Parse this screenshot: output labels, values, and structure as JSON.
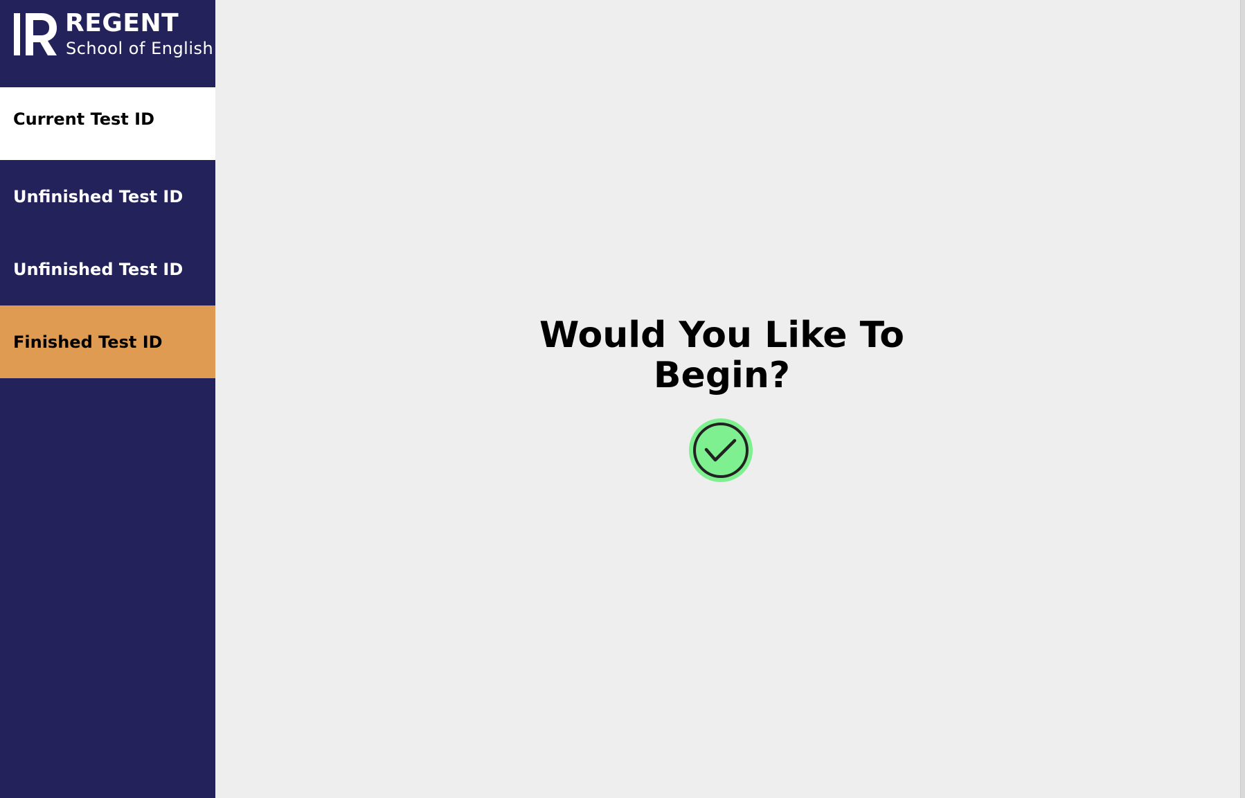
{
  "brand": {
    "name": "REGENT",
    "subtitle": "School of English",
    "icon": "regent-r-logo-icon"
  },
  "sidebar": {
    "items": [
      {
        "label": "Current Test ID",
        "state": "current"
      },
      {
        "label": "Unfinished Test ID",
        "state": "unfinished"
      },
      {
        "label": "Unfinished Test ID",
        "state": "unfinished"
      },
      {
        "label": "Finished Test ID",
        "state": "finished"
      }
    ]
  },
  "main": {
    "prompt_line1": "Would You Like To",
    "prompt_line2": "Begin?",
    "confirm_icon": "checkmark-circle-icon"
  },
  "colors": {
    "sidebar_bg": "#24225a",
    "current_bg": "#ffffff",
    "finished_bg": "#de9b51",
    "main_bg": "#eeeeee",
    "confirm_bg": "#7ef08f"
  }
}
